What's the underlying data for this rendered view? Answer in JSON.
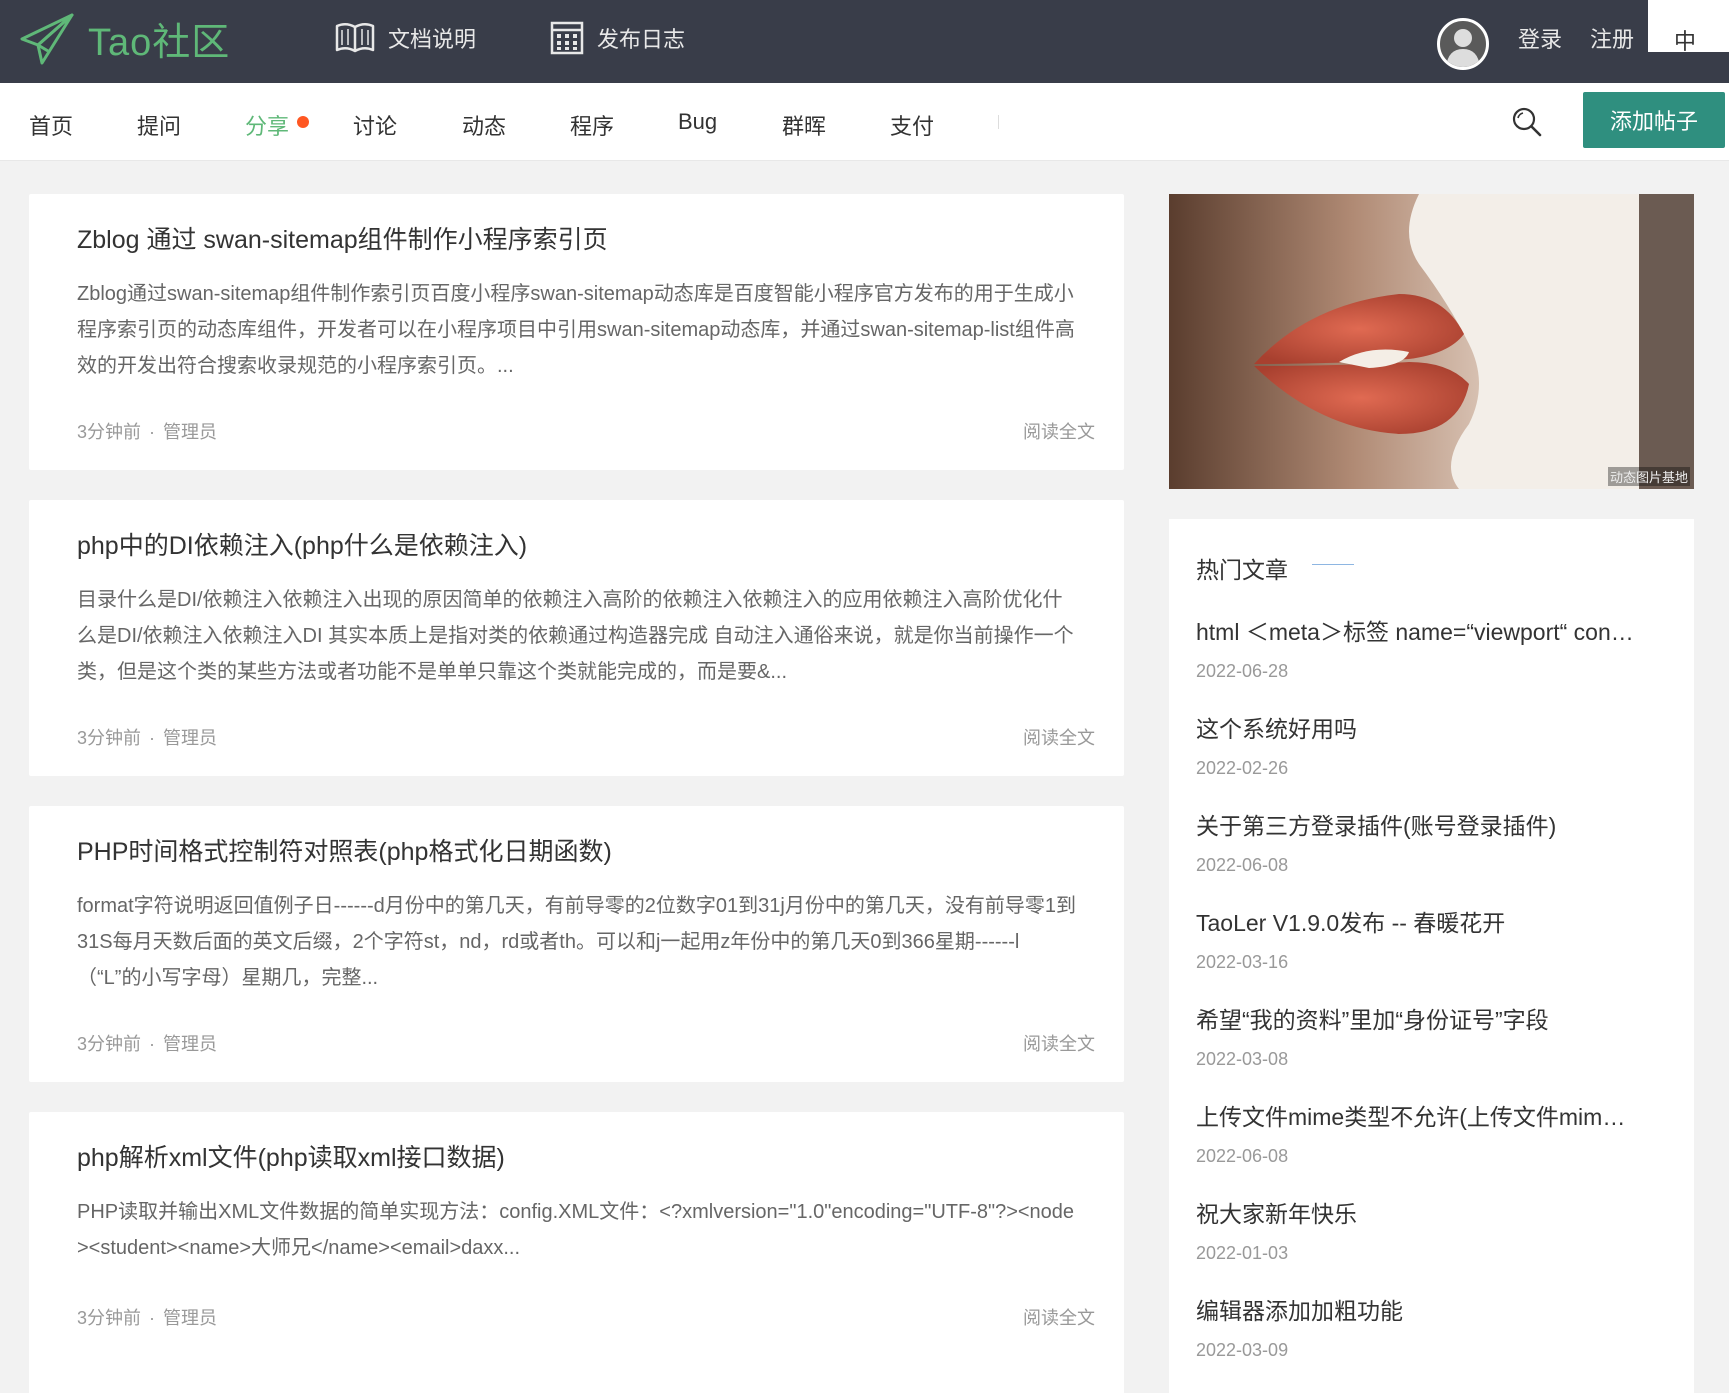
{
  "header": {
    "logo_text": "Tao社区",
    "docs_label": "文档说明",
    "changelog_label": "发布日志",
    "login_label": "登录",
    "register_label": "注册",
    "lang_label": "中"
  },
  "nav": {
    "items": [
      {
        "label": "首页"
      },
      {
        "label": "提问"
      },
      {
        "label": "分享"
      },
      {
        "label": "讨论"
      },
      {
        "label": "动态"
      },
      {
        "label": "程序"
      },
      {
        "label": "Bug"
      },
      {
        "label": "群晖"
      },
      {
        "label": "支付"
      }
    ],
    "active": "分享",
    "add_post_label": "添加帖子"
  },
  "posts": [
    {
      "title": "Zblog 通过 swan-sitemap组件制作小程序索引页",
      "excerpt": "Zblog通过swan-sitemap组件制作索引页百度小程序swan-sitemap动态库是百度智能小程序官方发布的用于生成小程序索引页的动态库组件，开发者可以在小程序项目中引用swan-sitemap动态库，并通过swan-sitemap-list组件高效的开发出符合搜索收录规范的小程序索引页。...",
      "time": "3分钟前",
      "author": "管理员",
      "read_more": "阅读全文"
    },
    {
      "title": "php中的DI依赖注入(php什么是依赖注入)",
      "excerpt": "目录什么是DI/依赖注入依赖注入出现的原因简单的依赖注入高阶的依赖注入依赖注入的应用依赖注入高阶优化什么是DI/依赖注入依赖注入DI 其实本质上是指对类的依赖通过构造器完成 自动注入通俗来说，就是你当前操作一个类，但是这个类的某些方法或者功能不是单单只靠这个类就能完成的，而是要&...",
      "time": "3分钟前",
      "author": "管理员",
      "read_more": "阅读全文"
    },
    {
      "title": "PHP时间格式控制符对照表(php格式化日期函数)",
      "excerpt": "format字符说明返回值例子日------d月份中的第几天，有前导零的2位数字01到31j月份中的第几天，没有前导零1到31S每月天数后面的英文后缀，2个字符st，nd，rd或者th。可以和j一起用z年份中的第几天0到366星期------l（“L”的小写字母）星期几，完整...",
      "time": "3分钟前",
      "author": "管理员",
      "read_more": "阅读全文"
    },
    {
      "title": "php解析xml文件(php读取xml接口数据)",
      "excerpt": "PHP读取并输出XML文件数据的简单实现方法：config.XML文件：<?xmlversion=\"1.0\"encoding=\"UTF-8\"?><node><student><name>大师兄</name><email>daxx...",
      "time": "3分钟前",
      "author": "管理员",
      "read_more": "阅读全文"
    }
  ],
  "sidebar": {
    "image_watermark": "动态图片基地",
    "hot_title": "热门文章",
    "hot_articles": [
      {
        "title": "html ＜meta＞标签 name=“viewport“ content=“width=device-width",
        "date": "2022-06-28"
      },
      {
        "title": "这个系统好用吗",
        "date": "2022-02-26"
      },
      {
        "title": "关于第三方登录插件(账号登录插件)",
        "date": "2022-06-08"
      },
      {
        "title": "TaoLer V1.9.0发布 -- 春暖花开",
        "date": "2022-03-16"
      },
      {
        "title": "希望“我的资料”里加“身份证号”字段",
        "date": "2022-03-08"
      },
      {
        "title": "上传文件mime类型不允许(上传文件mime类型)",
        "date": "2022-06-08"
      },
      {
        "title": "祝大家新年快乐",
        "date": "2022-01-03"
      },
      {
        "title": "编辑器添加加粗功能",
        "date": "2022-03-09"
      }
    ]
  },
  "colors": {
    "topbar_bg": "#393d49",
    "brand_green": "#5fb878",
    "add_post_bg": "#2f8f7f",
    "hot_dot": "#ff5722"
  },
  "icons": {
    "logo": "paper-plane-icon",
    "docs": "book-icon",
    "changelog": "calendar-icon",
    "search": "search-icon",
    "avatar": "user-avatar-icon"
  }
}
